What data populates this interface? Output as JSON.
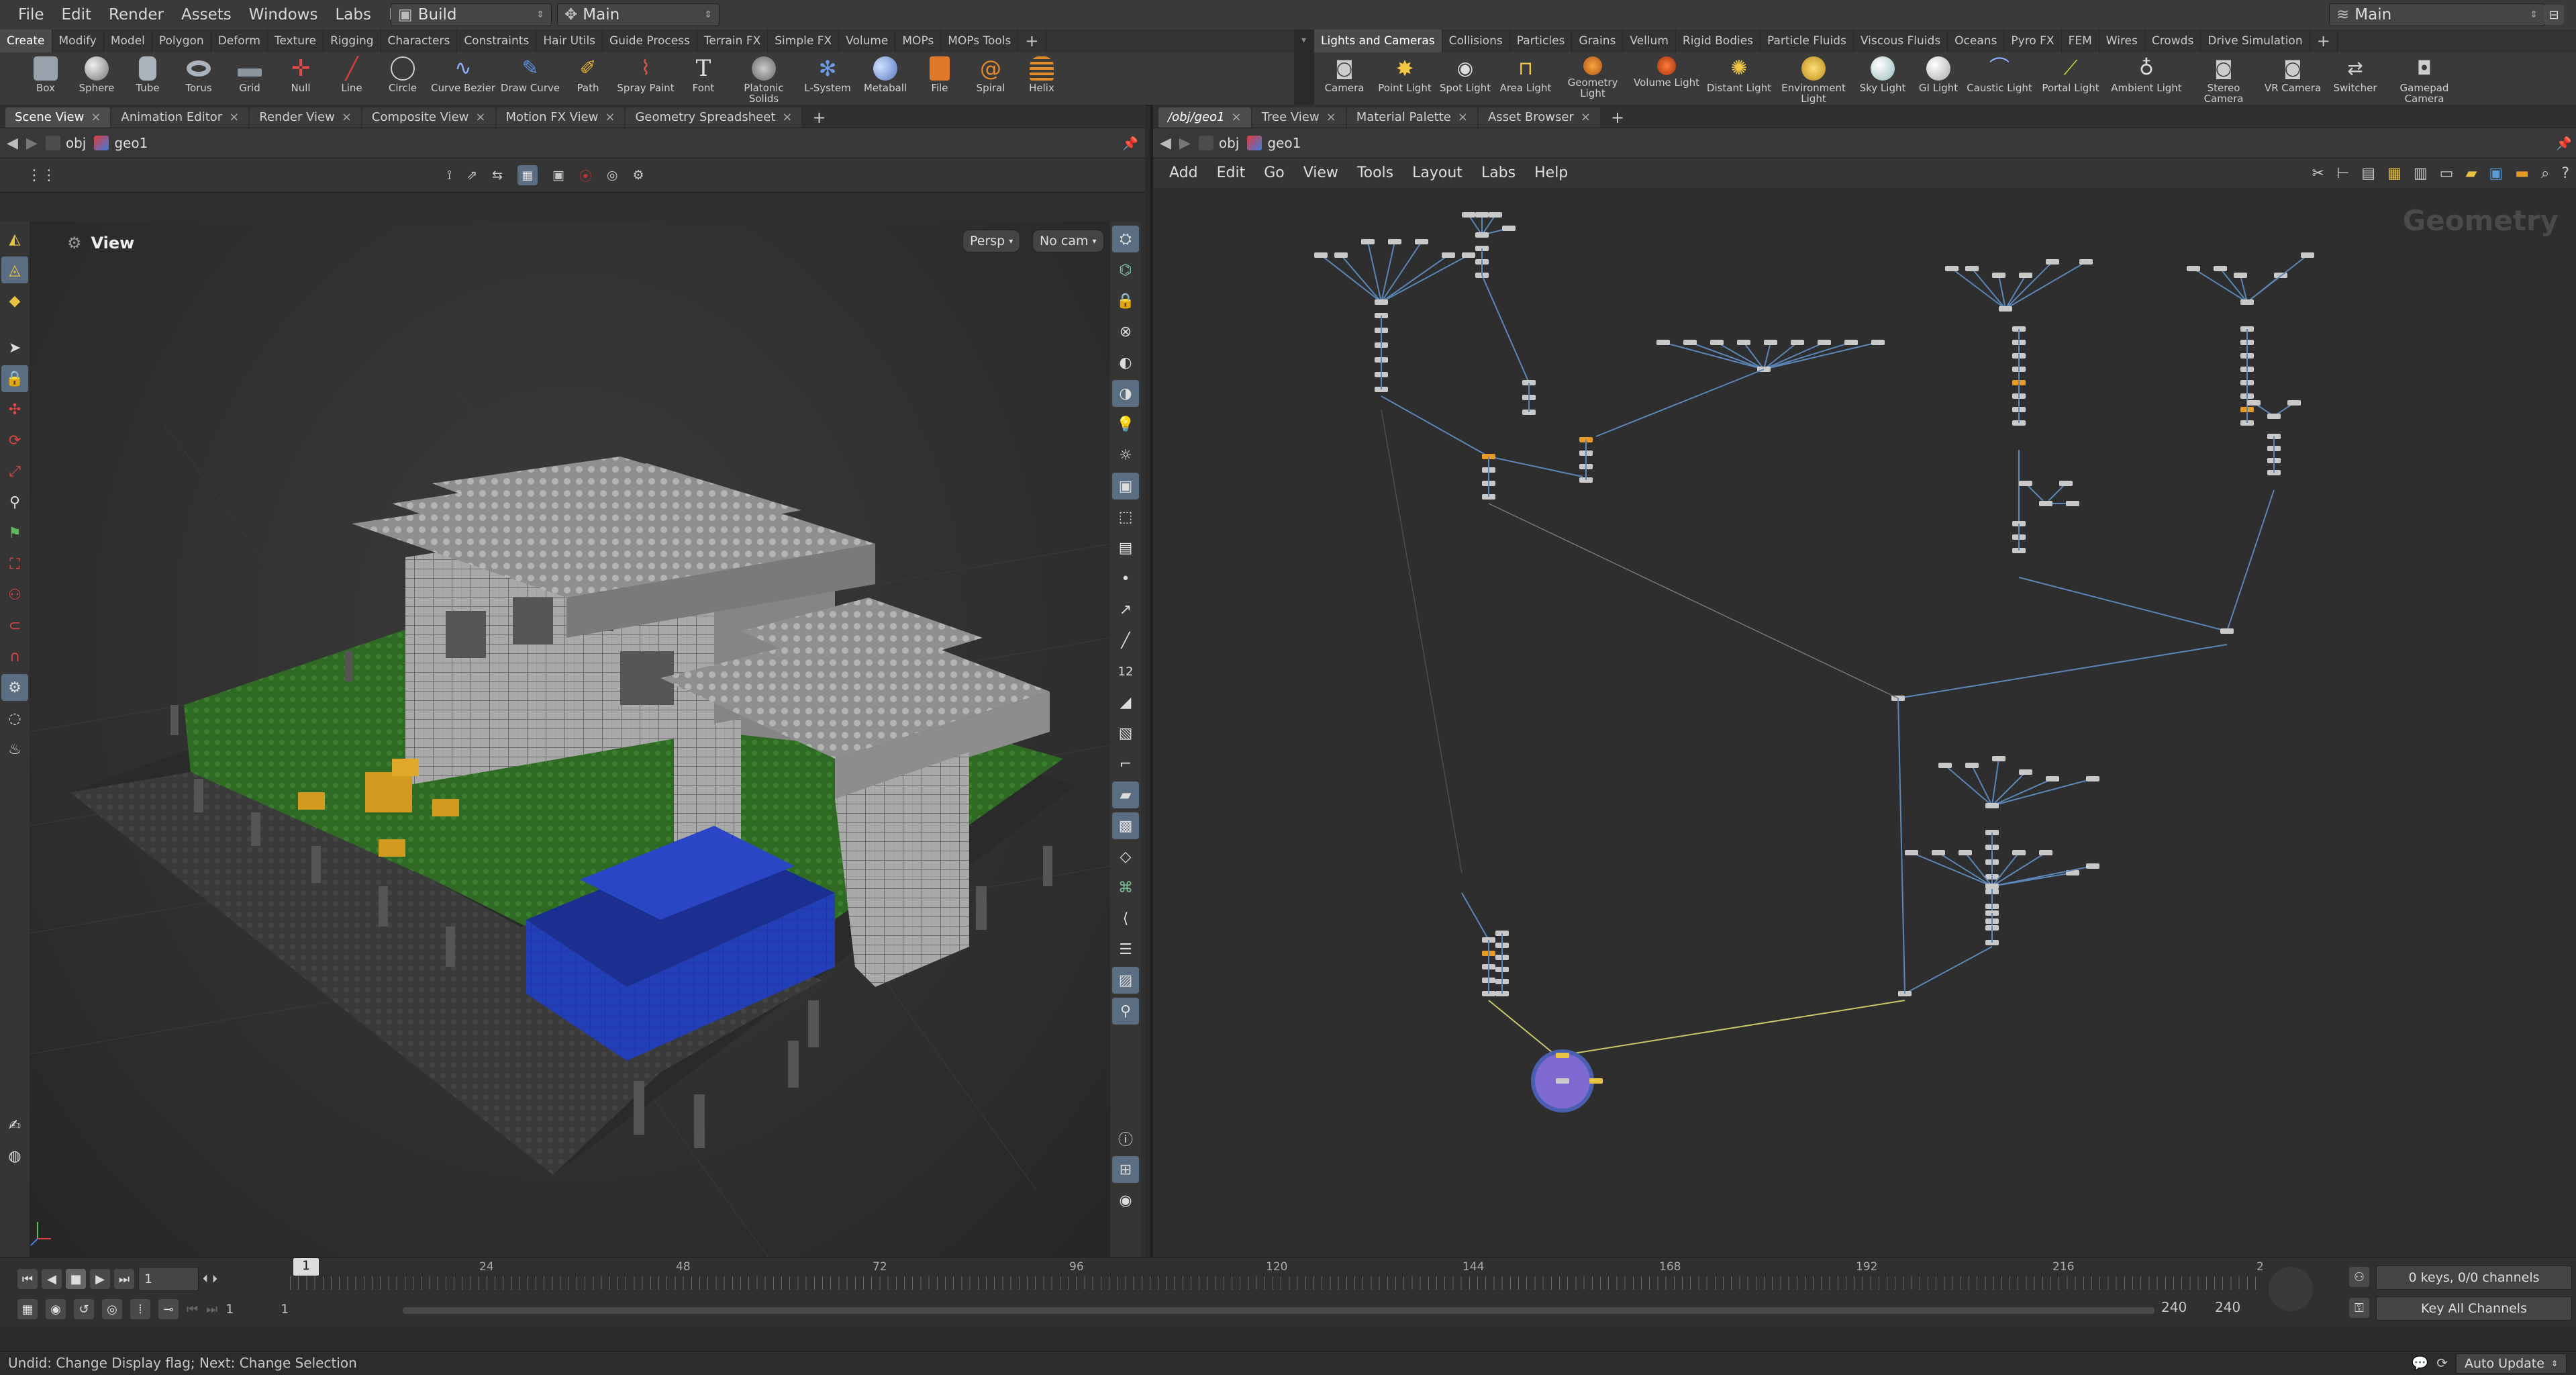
{
  "menubar": {
    "items": [
      "File",
      "Edit",
      "Render",
      "Assets",
      "Windows",
      "Labs",
      "Help"
    ],
    "desktop": "Build",
    "context": "Main",
    "right_context": "Main"
  },
  "shelf_left": {
    "tabs": [
      "Create",
      "Modify",
      "Model",
      "Polygon",
      "Deform",
      "Texture",
      "Rigging",
      "Characters",
      "Constraints",
      "Hair Utils",
      "Guide Process",
      "Terrain FX",
      "Simple FX",
      "Volume",
      "MOPs",
      "MOPs Tools"
    ],
    "active_tab": "Create",
    "tools": [
      "Box",
      "Sphere",
      "Tube",
      "Torus",
      "Grid",
      "Null",
      "Line",
      "Circle",
      "Curve Bezier",
      "Draw Curve",
      "Path",
      "Spray Paint",
      "Font",
      "Platonic Solids",
      "L-System",
      "Metaball",
      "File",
      "Spiral",
      "Helix"
    ]
  },
  "shelf_right": {
    "tabs": [
      "Lights and Cameras",
      "Collisions",
      "Particles",
      "Grains",
      "Vellum",
      "Rigid Bodies",
      "Particle Fluids",
      "Viscous Fluids",
      "Oceans",
      "Pyro FX",
      "FEM",
      "Wires",
      "Crowds",
      "Drive Simulation"
    ],
    "active_tab": "Lights and Cameras",
    "tools": [
      "Camera",
      "Point Light",
      "Spot Light",
      "Area Light",
      "Geometry Light",
      "Volume Light",
      "Distant Light",
      "Environment Light",
      "Sky Light",
      "GI Light",
      "Caustic Light",
      "Portal Light",
      "Ambient Light",
      "Stereo Camera",
      "VR Camera",
      "Switcher",
      "Gamepad Camera"
    ]
  },
  "left_pane": {
    "tabs": [
      "Scene View",
      "Animation Editor",
      "Render View",
      "Composite View",
      "Motion FX View",
      "Geometry Spreadsheet"
    ],
    "active_tab": "Scene View",
    "path": [
      "obj",
      "geo1"
    ],
    "viewport_label": "View",
    "persp_button": "Persp",
    "cam_button": "No cam",
    "side_badge": "12"
  },
  "right_pane": {
    "tabs": [
      "/obj/geo1",
      "Tree View",
      "Material Palette",
      "Asset Browser"
    ],
    "active_tab": "/obj/geo1",
    "path": [
      "obj",
      "geo1"
    ],
    "menu": [
      "Add",
      "Edit",
      "Go",
      "View",
      "Tools",
      "Layout",
      "Labs",
      "Help"
    ],
    "context_label": "Geometry"
  },
  "timeline": {
    "current_frame": "1",
    "frame_marker": "1",
    "ticks": [
      "24",
      "48",
      "72",
      "96",
      "120",
      "144",
      "168",
      "192",
      "216",
      "2"
    ],
    "range_start": "1",
    "range_start2": "1",
    "range_end": "240",
    "range_end2": "240",
    "keys_info": "0 keys, 0/0 channels",
    "key_all": "Key All Channels"
  },
  "status": {
    "message": "Undid: Change Display flag; Next: Change Selection",
    "auto_update": "Auto Update"
  },
  "colors": {
    "accent_orange": "#e79a25",
    "node_grey": "#c9c9c9",
    "wire_blue": "#5b86b8",
    "ground_green": "#2f6a24",
    "car_blue": "#1f37a6",
    "brick_grey": "#a9a9a9",
    "yellow_bricks": "#d29a1e",
    "output_node": "#7f6ad1"
  }
}
